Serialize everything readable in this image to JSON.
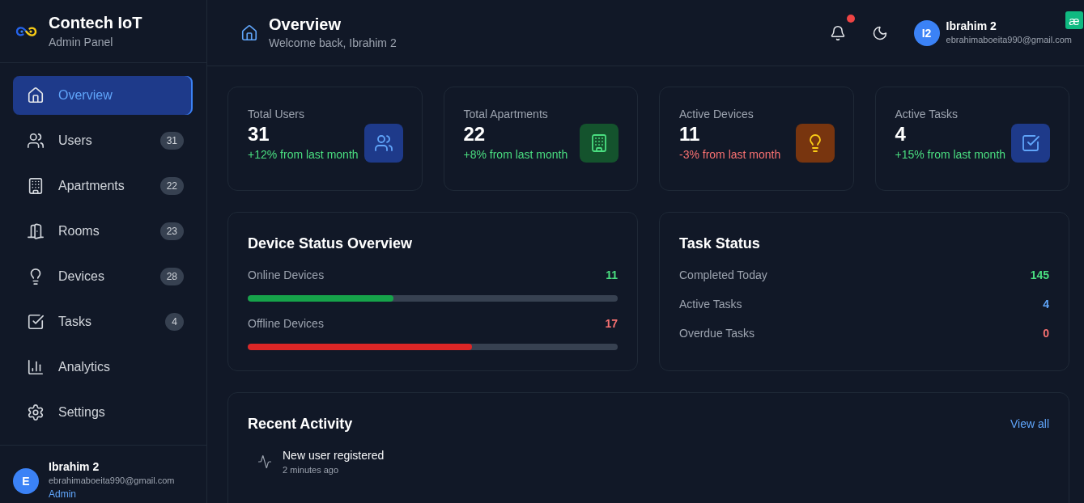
{
  "sidebar": {
    "brand": {
      "title": "Contech IoT",
      "subtitle": "Admin Panel"
    },
    "items": [
      {
        "label": "Overview",
        "selected": true
      },
      {
        "label": "Users",
        "badge": "31",
        "selected": false
      },
      {
        "label": "Apartments",
        "badge": "22",
        "selected": false
      },
      {
        "label": "Rooms",
        "badge": "23",
        "selected": false
      },
      {
        "label": "Devices",
        "badge": "28",
        "selected": false
      },
      {
        "label": "Tasks",
        "badge": "4",
        "selected": false
      },
      {
        "label": "Analytics",
        "selected": false
      },
      {
        "label": "Settings",
        "selected": false
      }
    ],
    "user": {
      "avatar_initial": "E",
      "name": "Ibrahim 2",
      "email": "ebrahimaboeita990@gmail.com",
      "role": "Admin"
    }
  },
  "header": {
    "title": "Overview",
    "subtitle": "Welcome back, Ibrahim 2",
    "has_notifications": true,
    "user": {
      "avatar_initials": "I2",
      "name": "Ibrahim 2",
      "email": "ebrahimaboeita990@gmail.com"
    }
  },
  "corner_badge": {
    "label": "æ"
  },
  "stats": [
    {
      "label": "Total Users",
      "value": "31",
      "change": "+12% from last month",
      "positive": true,
      "color": "#1e3a8a"
    },
    {
      "label": "Total Apartments",
      "value": "22",
      "change": "+8% from last month",
      "positive": true,
      "color": "#14532d"
    },
    {
      "label": "Active Devices",
      "value": "11",
      "change": "-3% from last month",
      "positive": false,
      "color": "#78350f"
    },
    {
      "label": "Active Tasks",
      "value": "4",
      "change": "+15% from last month",
      "positive": true,
      "color": "#1e3a8a"
    }
  ],
  "device_status": {
    "title": "Device Status Overview",
    "rows": [
      {
        "label": "Online Devices",
        "value": "11",
        "kind": "online",
        "level": 0.393
      },
      {
        "label": "Offline Devices",
        "value": "17",
        "kind": "offline",
        "level": 0.607
      }
    ]
  },
  "task_status": {
    "title": "Task Status",
    "rows": [
      {
        "label": "Completed Today",
        "value": "145",
        "color": "#4ade80"
      },
      {
        "label": "Active Tasks",
        "value": "4",
        "color": "#60a5fa"
      },
      {
        "label": "Overdue Tasks",
        "value": "0",
        "color": "#f87171"
      }
    ]
  },
  "recent_activity": {
    "title": "Recent Activity",
    "link": "View all",
    "items": [
      {
        "title": "New user registered",
        "time": "2 minutes ago"
      }
    ]
  }
}
